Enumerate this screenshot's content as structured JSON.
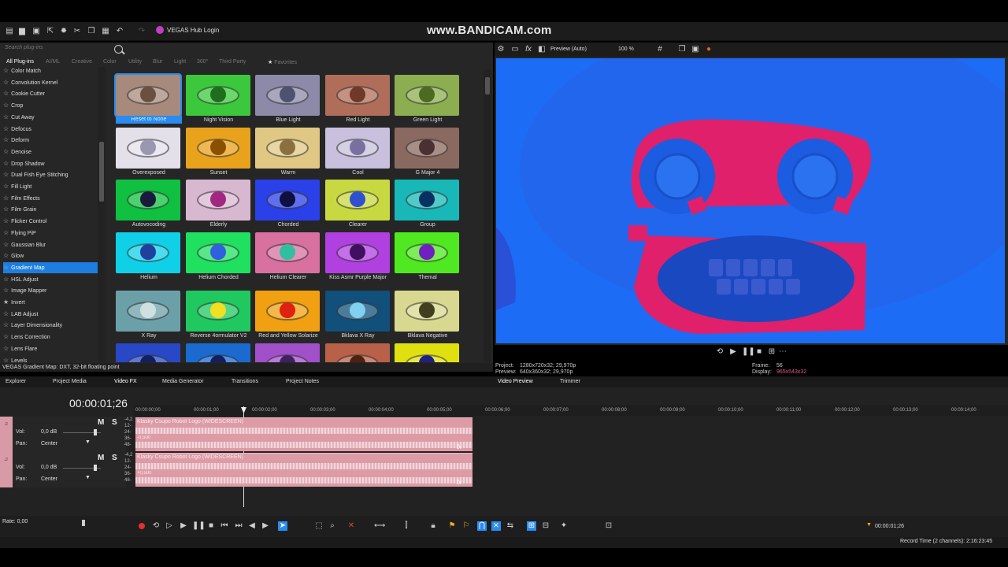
{
  "watermark": "www.BANDICAM.com",
  "toolbar": {
    "hub_login": "VEGAS Hub Login"
  },
  "plugins": {
    "search_placeholder": "Search plug-ins",
    "categories": [
      "All Plug-ins",
      "AI/ML",
      "Creative",
      "Color",
      "Utility",
      "Blur",
      "Light",
      "360°",
      "Third Party",
      "Favorites"
    ],
    "items": [
      "Color Match",
      "Convolution Kernel",
      "Cookie Cutter",
      "Crop",
      "Cut Away",
      "Defocus",
      "Deform",
      "Denoise",
      "Drop Shadow",
      "Dual Fish Eye Stitching",
      "Fill Light",
      "Film Effects",
      "Film Grain",
      "Flicker Control",
      "Flying PiP",
      "Gaussian Blur",
      "Glow",
      "Gradient Map",
      "HSL Adjust",
      "Image Mapper",
      "Invert",
      "LAB Adjust",
      "Layer Dimensionality",
      "Lens Correction",
      "Lens Flare",
      "Levels"
    ],
    "selected_item": "Gradient Map",
    "presets": [
      {
        "label": "Reset to None",
        "bg": "#a88a7c",
        "iris": "#6a5040"
      },
      {
        "label": "Night Vision",
        "bg": "#3cc83c",
        "iris": "#1e6e1e"
      },
      {
        "label": "Blue Light",
        "bg": "#8c8aa8",
        "iris": "#505070"
      },
      {
        "label": "Red  Light",
        "bg": "#b06e5a",
        "iris": "#703828"
      },
      {
        "label": "Green Light",
        "bg": "#8cae50",
        "iris": "#4c6a20"
      },
      {
        "label": "Overexposed",
        "bg": "#e4e0ea",
        "iris": "#9a98b0"
      },
      {
        "label": "Sunset",
        "bg": "#e8a21c",
        "iris": "#8a5000"
      },
      {
        "label": "Warm",
        "bg": "#e0c884",
        "iris": "#8a7040"
      },
      {
        "label": "Cool",
        "bg": "#c8c0dc",
        "iris": "#7a70a0"
      },
      {
        "label": "G Major 4",
        "bg": "#8a6a60",
        "iris": "#4a3030"
      },
      {
        "label": "Autovocoding",
        "bg": "#10c040",
        "iris": "#1a1a3c"
      },
      {
        "label": "Elderly",
        "bg": "#d8b8d0",
        "iris": "#a02880"
      },
      {
        "label": "Chorded",
        "bg": "#2a40e8",
        "iris": "#101040"
      },
      {
        "label": "Clearer",
        "bg": "#c8d840",
        "iris": "#3050d0"
      },
      {
        "label": "Group",
        "bg": "#18b8b8",
        "iris": "#083060"
      },
      {
        "label": "Helium",
        "bg": "#10d0e8",
        "iris": "#2040a0"
      },
      {
        "label": "Helium Chorded",
        "bg": "#20e060",
        "iris": "#3060e0"
      },
      {
        "label": "Helium Clearer",
        "bg": "#d870a0",
        "iris": "#30c0a0"
      },
      {
        "label": "Kiss Asmr Purple Major",
        "bg": "#b040e0",
        "iris": "#401060"
      },
      {
        "label": "Themal",
        "bg": "#50e820",
        "iris": "#7020c0"
      },
      {
        "label": "X Ray",
        "bg": "#6ca0a8",
        "iris": "#d0e0e0"
      },
      {
        "label": "Reverse 4ormulator V2",
        "bg": "#20c860",
        "iris": "#f0e020"
      },
      {
        "label": "Red and Yellow Solarize",
        "bg": "#f0a010",
        "iris": "#e02010"
      },
      {
        "label": "Bklava X Ray",
        "bg": "#10507a",
        "iris": "#80d0f0"
      },
      {
        "label": "Bklava Negative",
        "bg": "#d8d890",
        "iris": "#404020"
      },
      {
        "label": "",
        "bg": "#2848c8",
        "iris": "#102060"
      },
      {
        "label": "",
        "bg": "#1a6ad0",
        "iris": "#102060"
      },
      {
        "label": "",
        "bg": "#a050c8",
        "iris": "#402060"
      },
      {
        "label": "",
        "bg": "#b86048",
        "iris": "#502010"
      },
      {
        "label": "",
        "bg": "#e0e010",
        "iris": "#202080"
      }
    ],
    "status": "VEGAS Gradient Map: DXT, 32-bit floating point"
  },
  "bottom_tabs": [
    "Explorer",
    "Project Media",
    "Video FX",
    "Media Generator",
    "Transitions",
    "Project Notes",
    "Video Preview",
    "Trimmer"
  ],
  "preview": {
    "mode": "Preview (Auto)",
    "zoom": "100 %",
    "project_label": "Project:",
    "project_value": "1280x720x32; 29,970p",
    "preview_label": "Preview:",
    "preview_value": "640x360x32; 29,970p",
    "frame_label": "Frame:",
    "frame_value": "56",
    "display_label": "Display:",
    "display_value": "965x543x32",
    "bg_color": "#1c6cf5",
    "accent_color": "#e0206a"
  },
  "timeline": {
    "timecode": "00:00:01;26",
    "ruler": [
      "00:00:00;00",
      "00:00:01;00",
      "00:00:02;00",
      "00:00:03;00",
      "00:00:04;00",
      "00:00:05;00",
      "00:00:06;00",
      "00:00:07;00",
      "00:00:08;00",
      "00:00:09;00",
      "00:00:10;00",
      "00:00:11;00",
      "00:00:12;00",
      "00:00:13;00",
      "00:00:14;00"
    ],
    "tracks": [
      {
        "vol_label": "Vol:",
        "vol_value": "0,0 dB",
        "pan_label": "Pan:",
        "pan_value": "Center",
        "clip_name": "Klasky Csupo Robot Logo (WIDESCREEN)",
        "clip_sub": "-0,500",
        "meter": [
          "-4,2",
          "12-",
          "24-",
          "36-",
          "48-"
        ]
      },
      {
        "vol_label": "Vol:",
        "vol_value": "0,0 dB",
        "pan_label": "Pan:",
        "pan_value": "Center",
        "clip_name": "Klasky Csupo Robot Logo (WIDESCREEN)",
        "clip_sub": "+0,500",
        "meter": [
          "-4,2",
          "12-",
          "24-",
          "36-",
          "48-"
        ]
      }
    ],
    "mute": "M",
    "solo": "S",
    "rate": "Rate: 0,00",
    "cursor_time": "00:00:01;26",
    "record_time": "Record Time (2 channels): 2:16:23:45"
  }
}
